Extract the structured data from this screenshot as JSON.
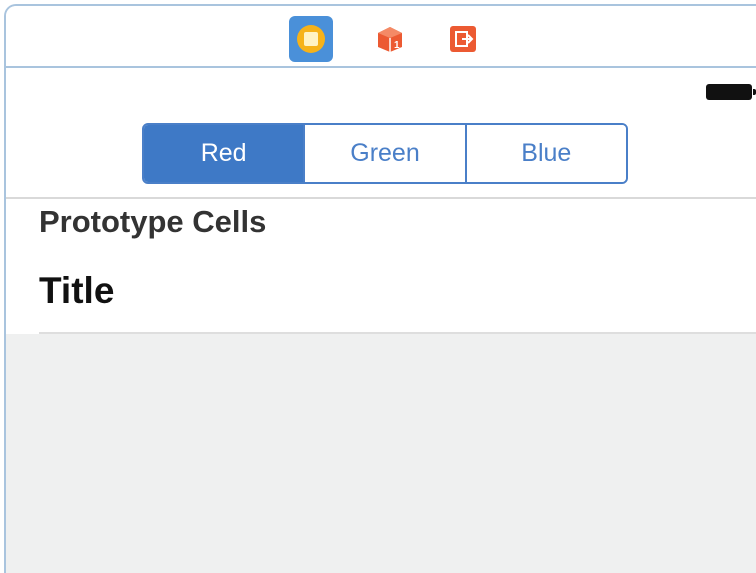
{
  "dock": {
    "items": [
      {
        "icon": "view-controller-icon",
        "color": "#f6b21a",
        "selected": true
      },
      {
        "icon": "first-responder-icon",
        "color": "#ec5a32"
      },
      {
        "icon": "exit-icon",
        "color": "#ec5a32"
      }
    ]
  },
  "status_bar": {
    "battery_icon": "battery-icon"
  },
  "segmented_control": {
    "segments": [
      "Red",
      "Green",
      "Blue"
    ],
    "selected_index": 0,
    "accent": "#3e79c6"
  },
  "table": {
    "section_header": "Prototype Cells",
    "cells": [
      {
        "title": "Title"
      }
    ],
    "background": "#eff0f0"
  }
}
